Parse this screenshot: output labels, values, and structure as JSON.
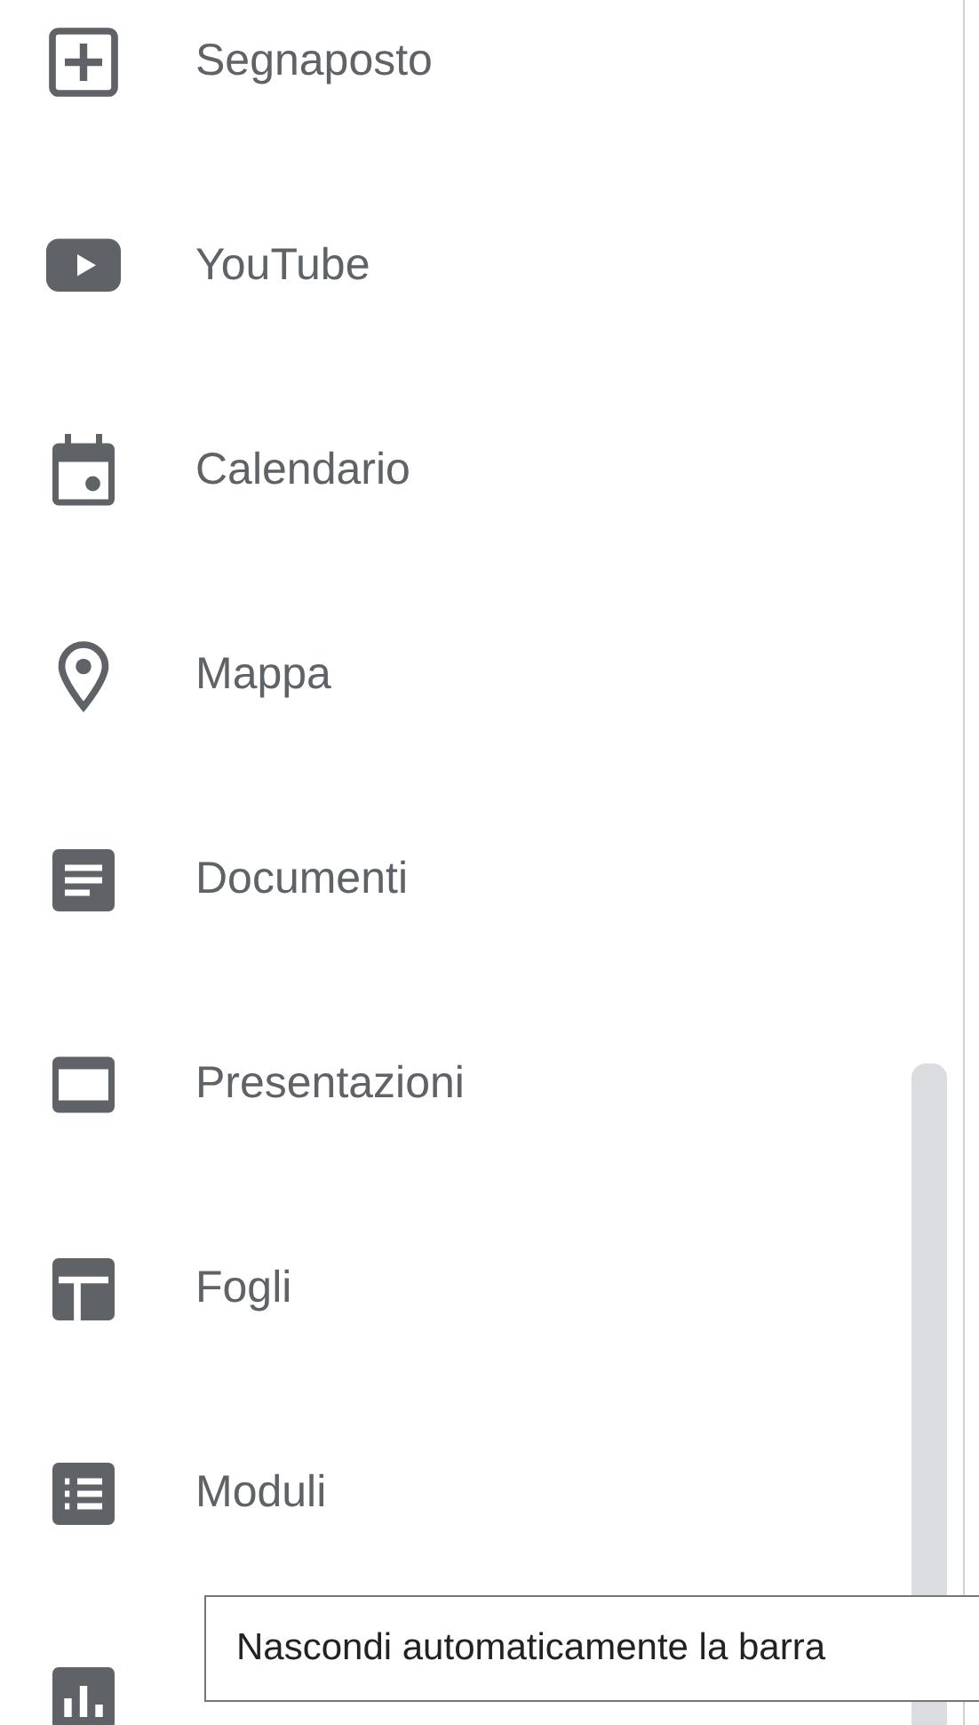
{
  "menu": {
    "items": [
      {
        "label": "Segnaposto"
      },
      {
        "label": "YouTube"
      },
      {
        "label": "Calendario"
      },
      {
        "label": "Mappa"
      },
      {
        "label": "Documenti"
      },
      {
        "label": "Presentazioni"
      },
      {
        "label": "Fogli"
      },
      {
        "label": "Moduli"
      }
    ]
  },
  "tooltip": {
    "text": "Nascondi automaticamente la barra"
  }
}
